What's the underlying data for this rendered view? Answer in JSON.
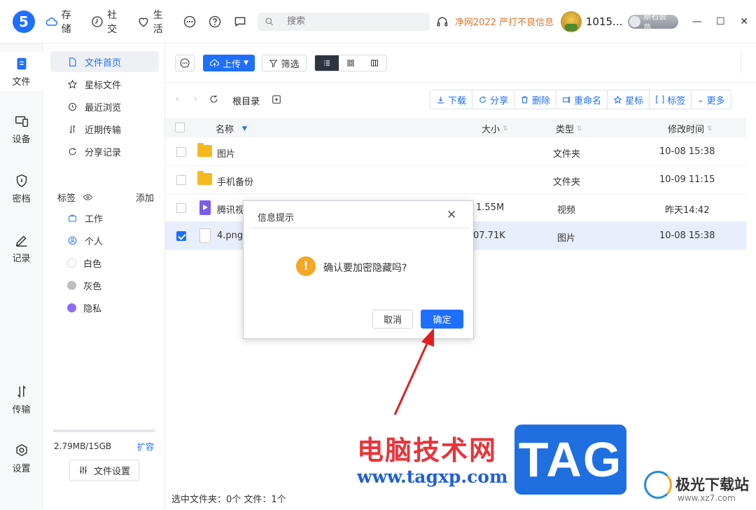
{
  "topbar": {
    "logo": "5",
    "nav": [
      {
        "label": "存储",
        "icon": "cloud-icon"
      },
      {
        "label": "社交",
        "icon": "clock-icon"
      },
      {
        "label": "生活",
        "icon": "heart-icon"
      }
    ],
    "search_placeholder": "搜索",
    "promo": "净网2022 严打不良信息",
    "username": "1015...",
    "member_badge": "原石会员"
  },
  "rail": {
    "items": [
      {
        "label": "文件",
        "icon": "file-icon"
      },
      {
        "label": "设备",
        "icon": "device-icon"
      },
      {
        "label": "密档",
        "icon": "shield-icon"
      },
      {
        "label": "记录",
        "icon": "pen-icon"
      },
      {
        "label": "传输",
        "icon": "transfer-icon"
      },
      {
        "label": "设置",
        "icon": "settings-icon"
      }
    ]
  },
  "sidebar": {
    "items": [
      {
        "label": "文件首页"
      },
      {
        "label": "星标文件"
      },
      {
        "label": "最近浏览"
      },
      {
        "label": "近期传输"
      },
      {
        "label": "分享记录"
      }
    ],
    "tags_title": "标签",
    "tags_add": "添加",
    "tags": [
      {
        "label": "工作",
        "color": "#3b7cff"
      },
      {
        "label": "个人",
        "color": "#3b7cff"
      },
      {
        "label": "白色",
        "color": "#ffffff"
      },
      {
        "label": "灰色",
        "color": "#bfbfbf"
      },
      {
        "label": "隐私",
        "color": "#8c6cf5"
      }
    ],
    "quota": "2.79MB/15GB",
    "quota_fraction": 0.0002,
    "expand": "扩容",
    "file_settings": "文件设置"
  },
  "toolbar": {
    "upload": "上传",
    "filter": "筛选"
  },
  "pathbar": {
    "crumb": "根目录",
    "actions": [
      {
        "label": "下载",
        "icon": "download-icon"
      },
      {
        "label": "分享",
        "icon": "share-icon"
      },
      {
        "label": "删除",
        "icon": "trash-icon"
      },
      {
        "label": "重命名",
        "icon": "rename-icon"
      },
      {
        "label": "星标",
        "icon": "star-icon"
      },
      {
        "label": "标签",
        "icon": "tag-icon"
      },
      {
        "label": "更多",
        "icon": "chevron-down-icon"
      }
    ]
  },
  "table": {
    "columns": {
      "name": "名称",
      "size": "大小",
      "type": "类型",
      "modified": "修改时间"
    },
    "rows": [
      {
        "name": "图片",
        "size": "",
        "type": "文件夹",
        "modified": "10-08 15:38",
        "kind": "folder",
        "checked": false
      },
      {
        "name": "手机备份",
        "size": "",
        "type": "文件夹",
        "modified": "10-09 11:15",
        "kind": "folder",
        "checked": false
      },
      {
        "name": "腾讯视",
        "size": "1.55M",
        "type": "视频",
        "modified": "昨天14:42",
        "kind": "video",
        "checked": false
      },
      {
        "name": "4.png",
        "size": "07.71K",
        "type": "图片",
        "modified": "10-08 15:38",
        "kind": "png",
        "checked": true
      }
    ]
  },
  "status": "选中文件夹：0个 文件：1个",
  "dialog": {
    "title": "信息提示",
    "message": "确认要加密隐藏吗?",
    "cancel": "取消",
    "ok": "确定"
  },
  "watermark": {
    "text": "电脑技术网",
    "url": "www.tagxp.com",
    "tag": "TAG",
    "site": "极光下载站",
    "site_url": "www.xz7.com"
  }
}
